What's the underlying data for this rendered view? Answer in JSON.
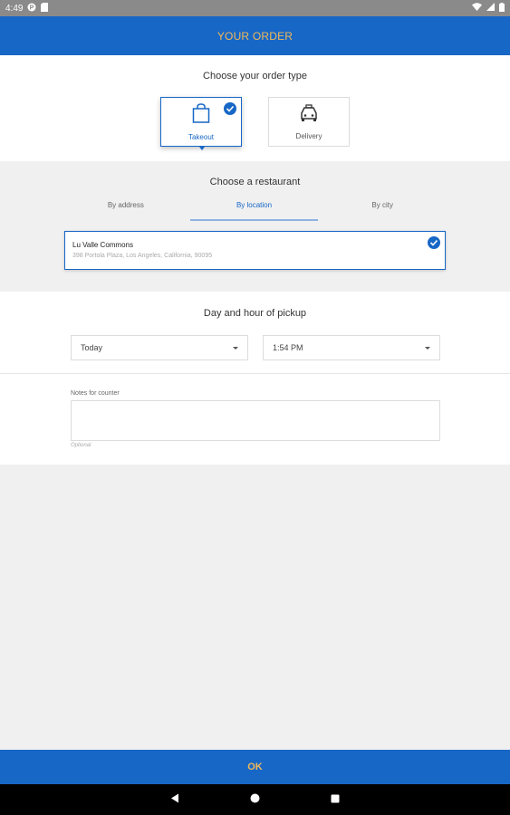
{
  "status_bar": {
    "time": "4:49"
  },
  "header": {
    "title": "YOUR ORDER"
  },
  "order_type": {
    "heading": "Choose your order type",
    "options": [
      {
        "label": "Takeout",
        "icon": "shopping-bag-icon",
        "selected": true
      },
      {
        "label": "Delivery",
        "icon": "car-icon",
        "selected": false
      }
    ]
  },
  "restaurant": {
    "heading": "Choose a restaurant",
    "tabs": [
      {
        "label": "By address",
        "active": false
      },
      {
        "label": "By location",
        "active": true
      },
      {
        "label": "By city",
        "active": false
      }
    ],
    "selected": {
      "name": "Lu Valle Commons",
      "address": "398 Portola Plaza, Los Angeles, California, 90095"
    }
  },
  "pickup": {
    "heading": "Day and hour of pickup",
    "day": "Today",
    "time": "1:54 PM"
  },
  "notes": {
    "label": "Notes for counter",
    "value": "",
    "hint": "Optional"
  },
  "footer": {
    "ok_label": "OK"
  },
  "colors": {
    "primary": "#1767c6",
    "accent": "#f1b95a",
    "background": "#f0f0f0"
  }
}
